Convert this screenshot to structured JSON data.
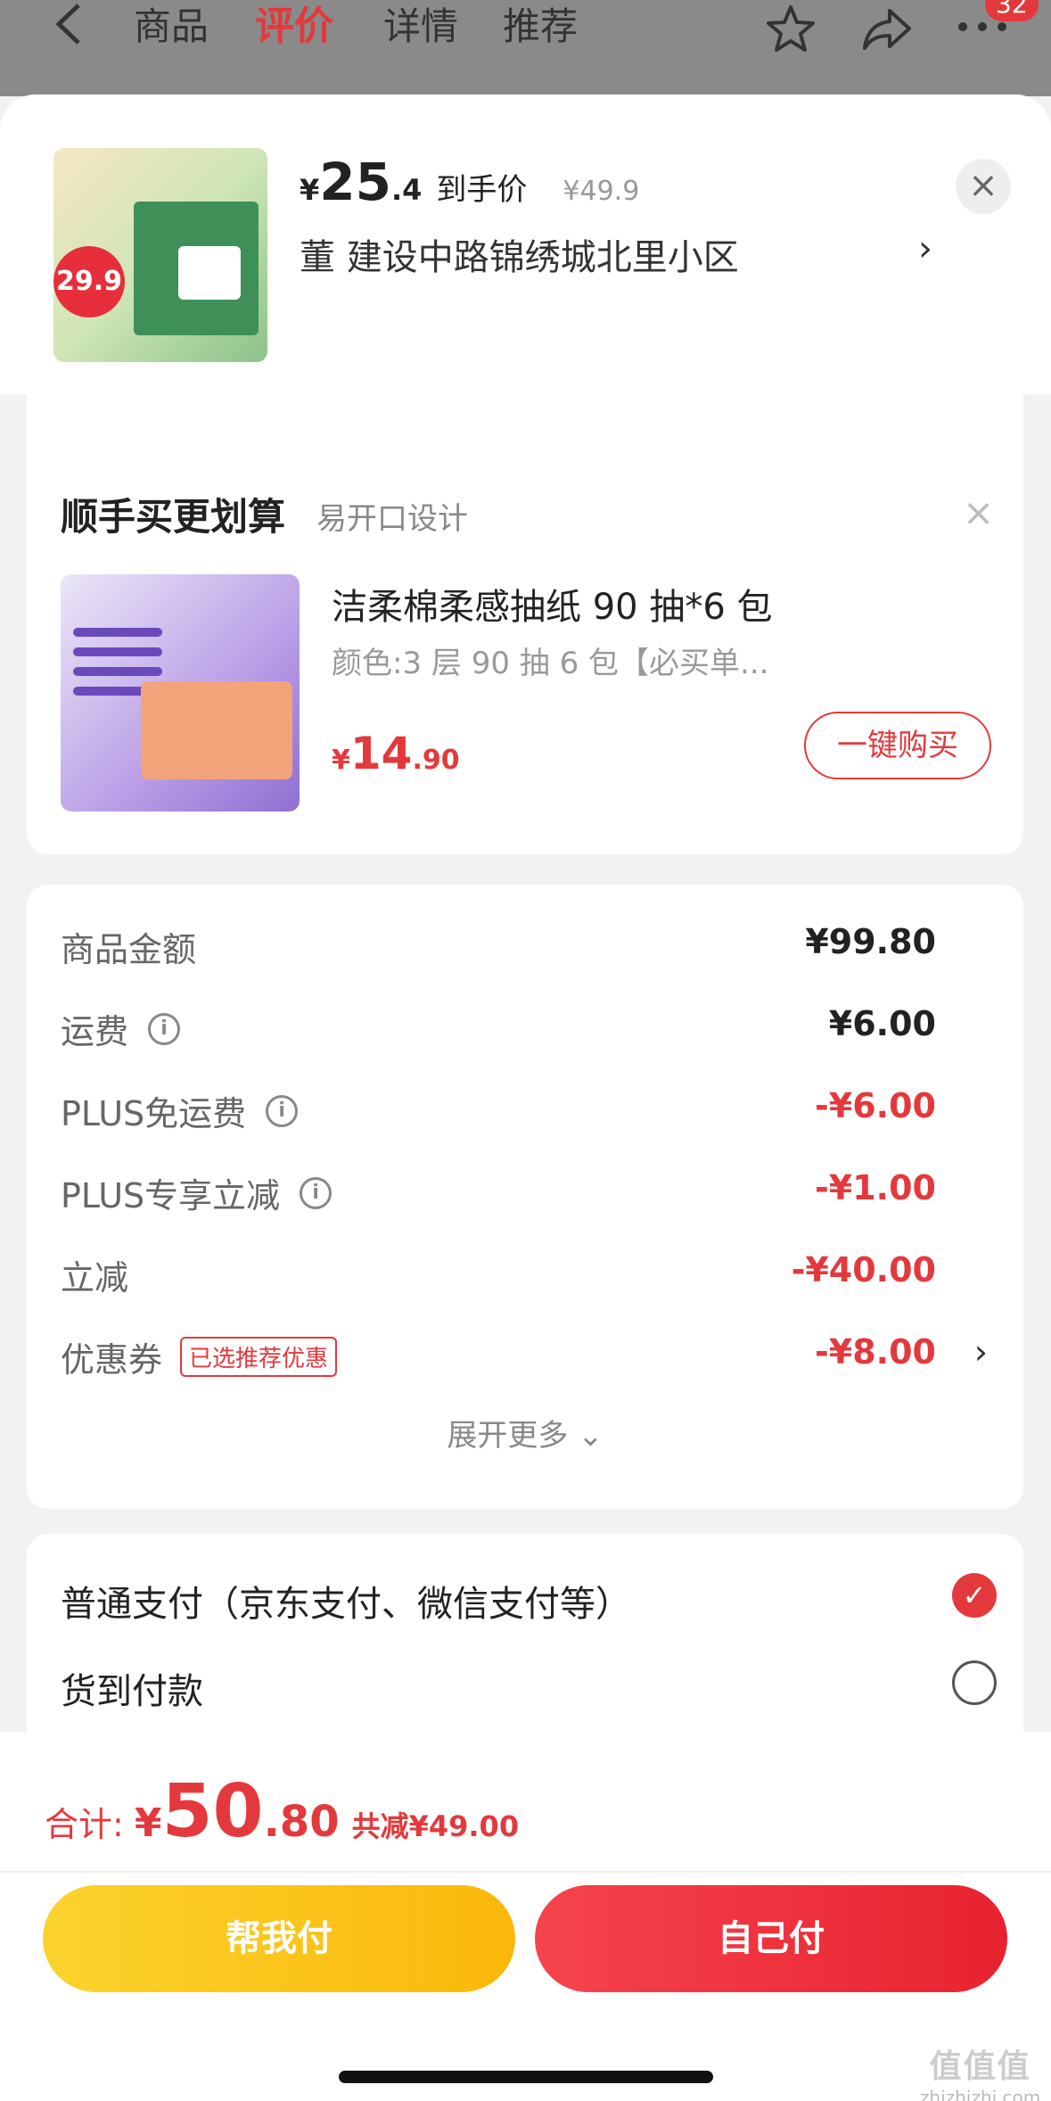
{
  "nav": {
    "tabs": [
      "商品",
      "评价",
      "详情",
      "推荐"
    ],
    "active_tab": "评价",
    "badge": "32",
    "icons": [
      "back-icon",
      "star-icon",
      "share-icon",
      "more-icon"
    ]
  },
  "product": {
    "thumb_price_text": "29.9",
    "currency": "¥",
    "price_int": "25",
    "price_dec": ".4",
    "price_label": "到手价",
    "original_price": "¥49.9",
    "address": "董  建设中路锦绣城北里小区",
    "close": "×",
    "chevron": "›"
  },
  "buy_together": {
    "title": "顺手买更划算",
    "subtitle": "易开口设计",
    "close": "×",
    "item_name": "洁柔棉柔感抽纸 90 抽*6 包",
    "item_spec": "颜色:3 层 90 抽 6 包【必买单...",
    "currency": "¥",
    "price_int": "14",
    "price_dec": ".90",
    "button": "一键购买"
  },
  "breakdown": {
    "rows": [
      {
        "label": "商品金额",
        "value": "¥99.80"
      },
      {
        "label": "运费",
        "value": "¥6.00"
      },
      {
        "label": "PLUS免运费",
        "value": "-¥6.00"
      },
      {
        "label": "PLUS专享立减",
        "value": "-¥1.00"
      },
      {
        "label": "立减",
        "value": "-¥40.00"
      },
      {
        "label": "优惠券",
        "value": "-¥8.00",
        "tag": "已选推荐优惠"
      }
    ],
    "expand": "展开更多 ⌄",
    "chevron": "›",
    "info": "i"
  },
  "payment": {
    "options": [
      {
        "label": "普通支付（京东支付、微信支付等）",
        "selected": true
      },
      {
        "label": "货到付款",
        "selected": false
      }
    ],
    "check": "✓"
  },
  "footer": {
    "total_label": "合计:",
    "currency": "¥",
    "total_int": "50",
    "total_dec": ".80",
    "savings": "共减¥49.00",
    "help_button": "帮我付",
    "self_button": "自己付"
  },
  "watermark": {
    "logo": "值值值",
    "site": "zhizhizhi.com"
  },
  "colors": {
    "accent": "#e4393c",
    "yellow": "#fbc31c"
  }
}
